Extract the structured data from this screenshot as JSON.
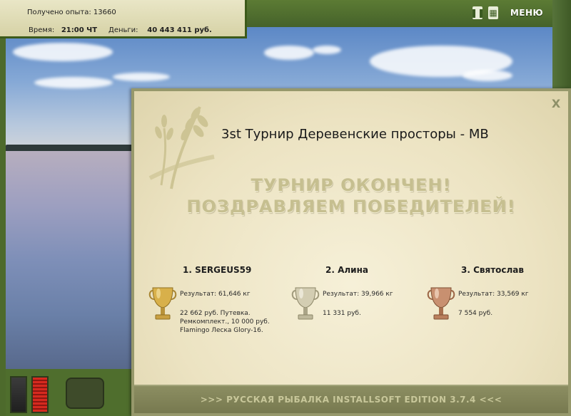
{
  "hud": {
    "experience_label": "Получено опыта:",
    "experience_value": "13660",
    "time_label": "Время:",
    "time_value": "21:00 ЧТ",
    "money_label": "Деньги:",
    "money_value": "40 443 411 руб."
  },
  "controls": {
    "pause_icon": "pause-icon",
    "grid_icon": "grid-icon",
    "menu_label": "МЕНЮ"
  },
  "dialog": {
    "close_label": "X",
    "title": "3st Турнир Деревенские просторы - MB",
    "banner_line1": "ТУРНИР ОКОНЧЕН!",
    "banner_line2": "ПОЗДРАВЛЯЕМ ПОБЕДИТЕЛЕЙ!",
    "winners": [
      {
        "place_name": "1. SERGEUS59",
        "result": "Результат: 61,646 кг",
        "prizes": [
          "22 662 руб. Путевка.",
          "Ремкомплект., 10 000 руб.",
          "Flamingo Леска Glory-16."
        ],
        "cup": "gold-cup-icon"
      },
      {
        "place_name": "2. Алина",
        "result": "Результат: 39,966 кг",
        "prizes": [
          "11 331 руб."
        ],
        "cup": "silver-cup-icon"
      },
      {
        "place_name": "3. Святослав",
        "result": "Результат: 33,569 кг",
        "prizes": [
          "7 554 руб."
        ],
        "cup": "bronze-cup-icon"
      }
    ],
    "footer": ">>> РУССКАЯ РЫБАЛКА INSTALLSOFT EDITION 3.7.4 <<<"
  },
  "colors": {
    "frame_green": "#4d6a2c",
    "dialog_bg": "#ece3c2",
    "banner_text": "#c6bf90",
    "gold": "#d8b04a",
    "silver": "#c9c4ad",
    "bronze": "#c0845a"
  }
}
